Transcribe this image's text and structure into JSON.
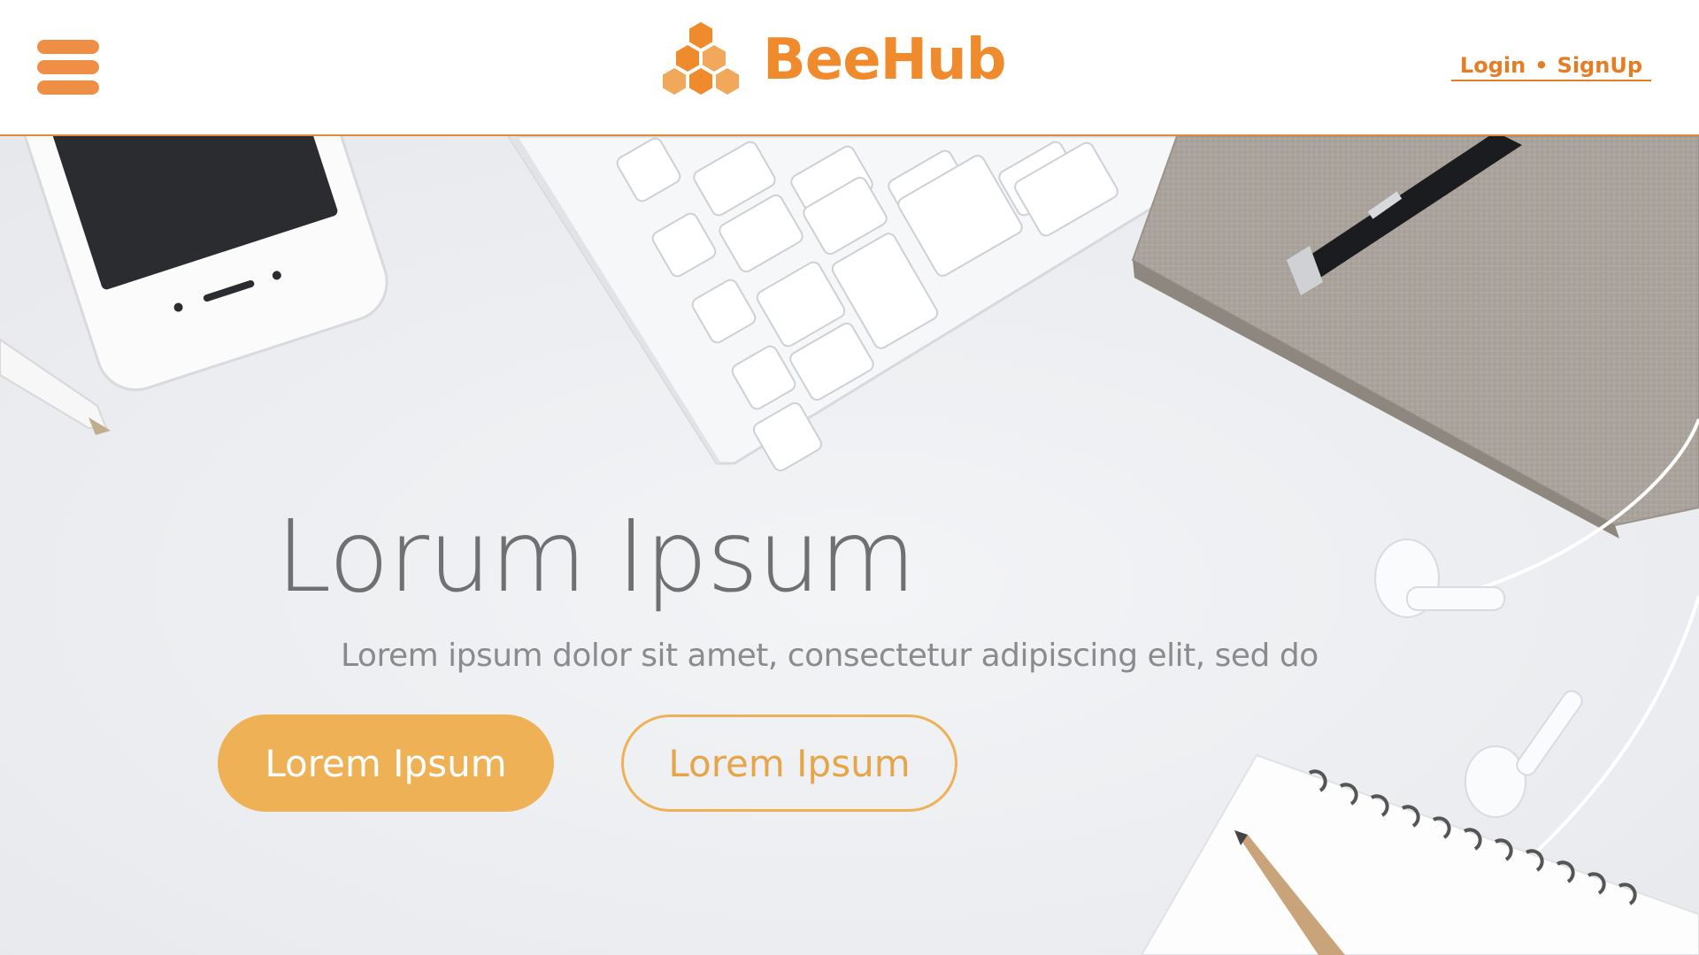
{
  "header": {
    "brand_name": "BeeHub",
    "auth": {
      "login_label": "Login",
      "separator": "•",
      "signup_label": "SignUp"
    },
    "icons": {
      "menu": "hamburger-menu-icon",
      "logo": "honeycomb-logo-icon"
    }
  },
  "hero": {
    "title": "Lorum Ipsum",
    "subtitle": "Lorem ipsum dolor sit amet, consectetur adipiscing elit, sed do",
    "primary_button_label": "Lorem Ipsum",
    "secondary_button_label": "Lorem Ipsum",
    "background_objects": [
      "smartphone",
      "keyboard",
      "notebook",
      "pen",
      "earphones",
      "spiral-notepad",
      "pencil"
    ]
  },
  "colors": {
    "brand_orange": "#ef8a2d",
    "button_orange": "#efb156",
    "header_border": "#e38a3a",
    "hero_background": "#eef0f3",
    "title_gray": "#6f7072"
  }
}
